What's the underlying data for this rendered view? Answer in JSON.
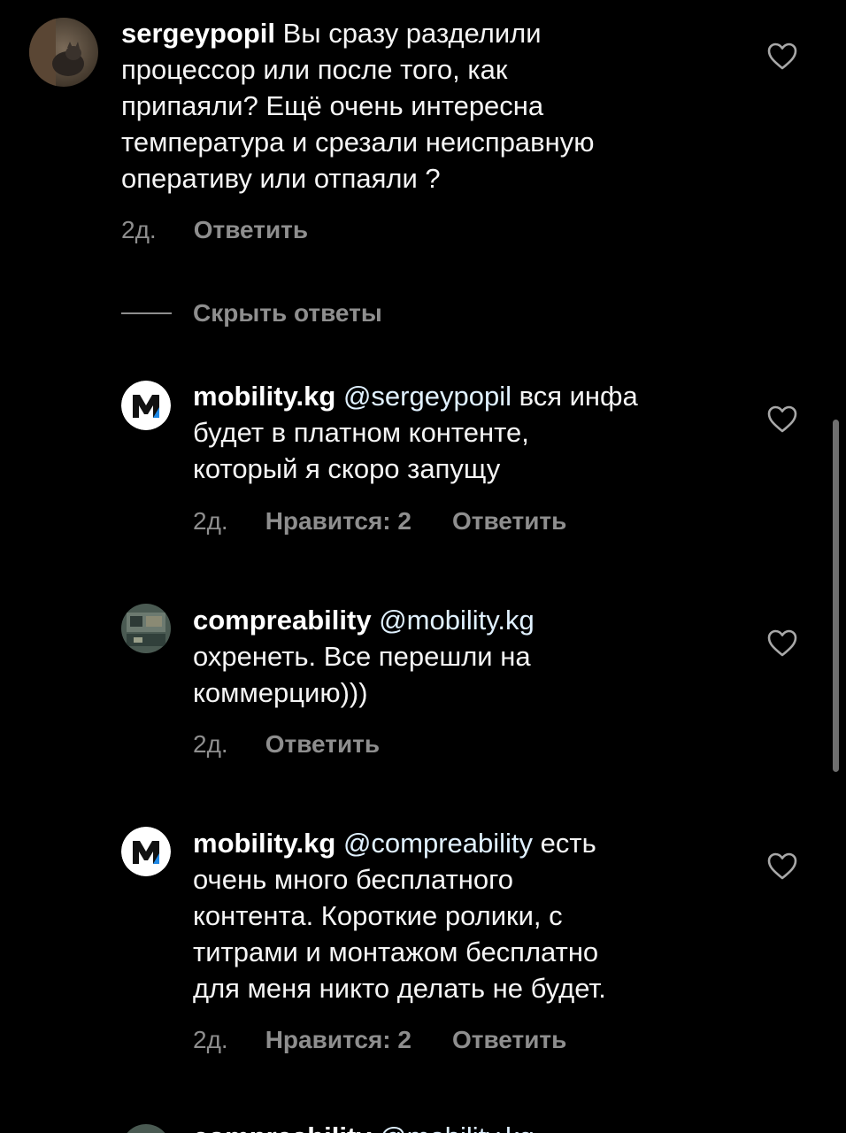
{
  "colors": {
    "background": "#000000",
    "text": "#f5f5f5",
    "mention": "#e0f1ff",
    "secondary": "#8e8e8e"
  },
  "comments": [
    {
      "username": "sergeypopil",
      "mention": "",
      "text": "Вы сразу разделили\nпроцессор или после того, как\nприпаяли? Ещё очень интересна\nтемпература и срезали неисправную\nоперативу или отпаяли ?",
      "time": "2д.",
      "likes": "",
      "reply": "Ответить",
      "avatar_icon": "cat-photo-avatar",
      "like_icon": "heart-outline-icon"
    },
    {
      "username": "mobility.kg",
      "mention": "@sergeypopil",
      "text": "вся инфа\nбудет в платном контенте,\nкоторый я скоро запущу",
      "time": "2д.",
      "likes": "Нравится: 2",
      "reply": "Ответить",
      "avatar_icon": "mobility-logo-avatar",
      "like_icon": "heart-outline-icon"
    },
    {
      "username": "compreability",
      "mention": "@mobility.kg",
      "text": "\nохренеть.  Все перешли на\nкоммерцию)))",
      "time": "2д.",
      "likes": "",
      "reply": "Ответить",
      "avatar_icon": "workshop-photo-avatar",
      "like_icon": "heart-outline-icon"
    },
    {
      "username": "mobility.kg",
      "mention": "@compreability",
      "text": "есть\nочень много бесплатного\nконтента. Короткие ролики, с\nтитрами и монтажом бесплатно\nдля меня никто делать не будет.",
      "time": "2д.",
      "likes": "Нравится: 2",
      "reply": "Ответить",
      "avatar_icon": "mobility-logo-avatar",
      "like_icon": "heart-outline-icon"
    }
  ],
  "hide_replies_label": "Скрыть ответы",
  "partial_comment": {
    "username": "compreability",
    "mention": "@mobility.kg"
  }
}
